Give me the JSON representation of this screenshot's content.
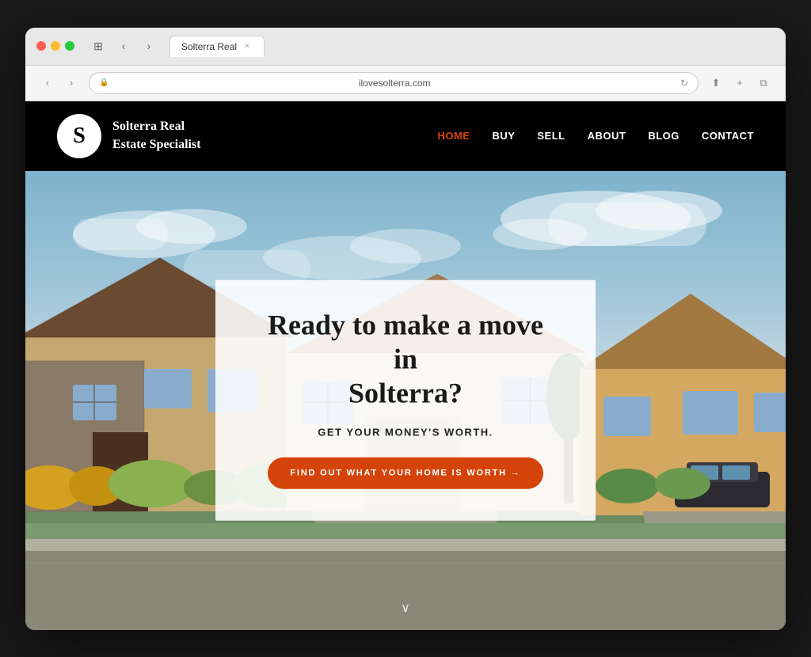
{
  "browser": {
    "traffic_lights": [
      "red",
      "yellow",
      "green"
    ],
    "url": "ilovesolterra.com",
    "tab_title": "Solterra Real Estate Specialist",
    "back_label": "‹",
    "forward_label": "›",
    "reload_label": "↻",
    "share_label": "⬆",
    "new_tab_label": "+",
    "windows_label": "⧉",
    "page_icon": "🔒"
  },
  "site": {
    "logo_letter": "S",
    "logo_line1": "Solterra Real",
    "logo_line2": "Estate Specialist"
  },
  "nav": {
    "items": [
      {
        "label": "HOME",
        "active": true
      },
      {
        "label": "BUY",
        "active": false
      },
      {
        "label": "SELL",
        "active": false
      },
      {
        "label": "ABOUT",
        "active": false
      },
      {
        "label": "BLOG",
        "active": false
      },
      {
        "label": "CONTACT",
        "active": false
      }
    ]
  },
  "hero": {
    "title_line1": "Ready to make a move in",
    "title_line2": "Solterra?",
    "subtitle": "GET YOUR MONEY'S WORTH.",
    "cta_label": "FIND OUT WHAT YOUR HOME IS WORTH →",
    "scroll_icon": "∨"
  },
  "colors": {
    "accent": "#d4440a",
    "nav_active": "#d4440a",
    "header_bg": "#000000",
    "hero_overlay_bg": "rgba(255,255,255,0.88)",
    "cta_bg": "#d4440a"
  }
}
